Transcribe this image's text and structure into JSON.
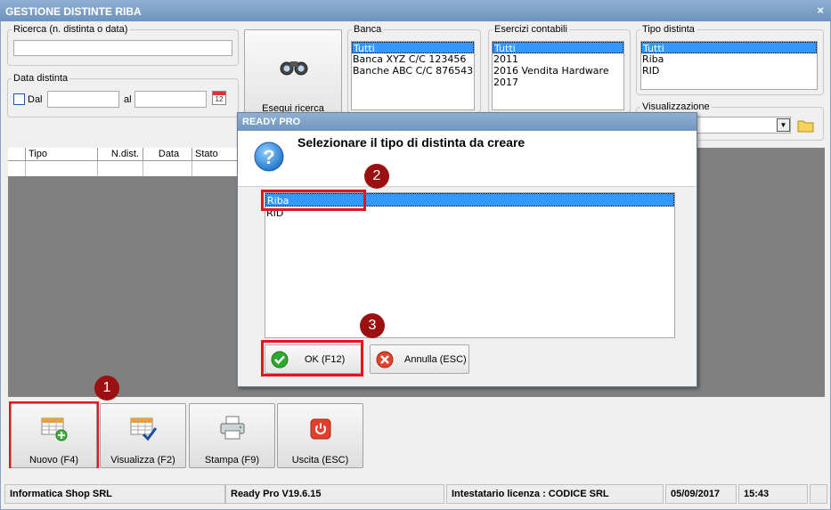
{
  "window": {
    "title": "GESTIONE DISTINTE RIBA",
    "close": "×"
  },
  "search": {
    "legend": "Ricerca (n. distinta o data)",
    "value": ""
  },
  "date": {
    "legend": "Data distinta",
    "dal_label": "Dal",
    "al_label": "al",
    "dal_value": "",
    "al_value": "",
    "calendar_num": "12"
  },
  "run_search": {
    "label": "Esegui ricerca"
  },
  "banca": {
    "legend": "Banca",
    "items": [
      "Tutti",
      "Banca XYZ C/C 123456",
      "Banche ABC C/C 876543"
    ],
    "selected": 0
  },
  "esercizi": {
    "legend": "Esercizi contabili",
    "items": [
      "Tutti",
      "2011",
      "2016 Vendita Hardware",
      "2017"
    ],
    "selected": 0
  },
  "tipo": {
    "legend": "Tipo distinta",
    "items": [
      "Tutti",
      "Riba",
      "RID"
    ],
    "selected": 0
  },
  "visualizzazione": {
    "legend": "Visualizzazione",
    "value": ""
  },
  "grid": {
    "columns": [
      "Tipo",
      "N.dist.",
      "Data",
      "Stato"
    ]
  },
  "dialog": {
    "title": "READY PRO",
    "heading": "Selezionare il tipo di distinta da creare",
    "items": [
      "Riba",
      "RID"
    ],
    "selected": 0,
    "ok_label": "OK (F12)",
    "cancel_label": "Annulla (ESC)"
  },
  "steps": [
    "1",
    "2",
    "3"
  ],
  "toolbar": {
    "nuovo": "Nuovo (F4)",
    "visualizza": "Visualizza (F2)",
    "stampa": "Stampa (F9)",
    "uscita": "Uscita (ESC)"
  },
  "statusbar": {
    "company": "Informatica Shop SRL",
    "version": "Ready Pro V19.6.15",
    "license": "Intestatario licenza : CODICE SRL",
    "date": "05/09/2017",
    "time": "15:43"
  },
  "colors": {
    "highlight": "#e8131a",
    "badge": "#9b1111",
    "selection": "#3399ff",
    "title_bar": "#7b9ec6"
  },
  "icons": [
    "binoculars-icon",
    "calendar-icon",
    "folder-icon",
    "question-icon",
    "check-icon",
    "cancel-icon",
    "new-grid-icon",
    "view-grid-icon",
    "printer-icon",
    "power-icon"
  ]
}
